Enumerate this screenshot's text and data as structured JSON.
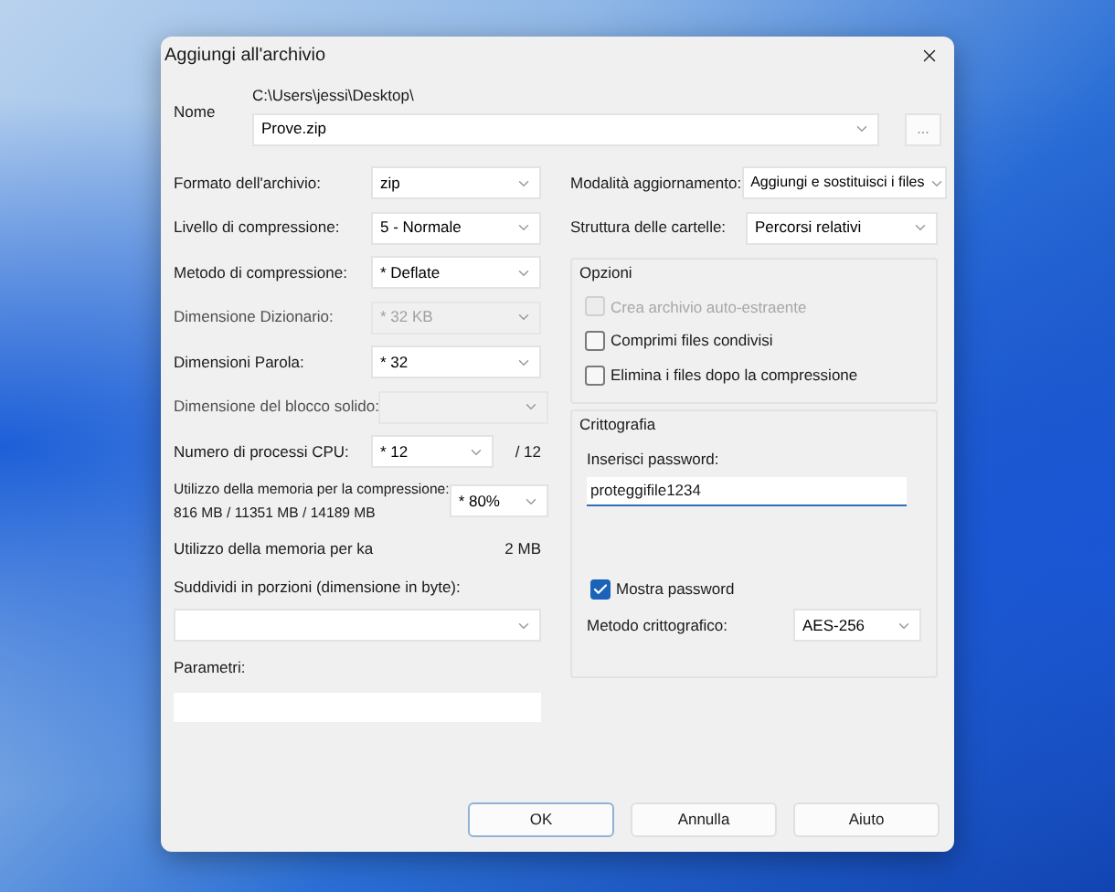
{
  "window": {
    "title": "Aggiungi all'archivio"
  },
  "name": {
    "label": "Nome",
    "path": "C:\\Users\\jessi\\Desktop\\",
    "value": "Prove.zip",
    "browse": "..."
  },
  "left_rows": [
    {
      "kind": "select",
      "label": "Formato dell'archivio:",
      "value": "zip",
      "disabled": false
    },
    {
      "kind": "select",
      "label": "Livello di compressione:",
      "value": "5 - Normale",
      "disabled": false
    },
    {
      "kind": "select",
      "label": "Metodo di compressione:",
      "value": "* Deflate",
      "disabled": false
    },
    {
      "kind": "select",
      "label": "Dimensione Dizionario:",
      "value": "* 32 KB",
      "disabled": true
    },
    {
      "kind": "select",
      "label": "Dimensioni Parola:",
      "value": "* 32",
      "disabled": false
    },
    {
      "kind": "select",
      "label": "Dimensione del blocco solido:",
      "disabled": true
    },
    {
      "kind": "select_suffix",
      "label": "Numero di processi CPU:",
      "value": "* 12",
      "suffix": "/ 12",
      "disabled": false
    },
    {
      "kind": "memory",
      "label": "Utilizzo della memoria per la compressione:",
      "sublabel": "816 MB / 11351 MB / 14189 MB",
      "value": "* 80%",
      "disabled": false
    },
    {
      "kind": "info",
      "label": "Utilizzo della memoria per ka",
      "reading": "2 MB"
    }
  ],
  "split": {
    "label": "Suddividi in porzioni (dimensione in byte):"
  },
  "parameters": {
    "label": "Parametri:"
  },
  "update_mode": {
    "label": "Modalità aggiornamento:",
    "value": "Aggiungi e sostituisci i files"
  },
  "folder_structure": {
    "label": "Struttura delle cartelle:",
    "value": "Percorsi relativi"
  },
  "options": {
    "title": "Opzioni",
    "items": [
      {
        "label": "Crea archivio auto-estraente",
        "checked": false,
        "disabled": true
      },
      {
        "label": "Comprimi files condivisi",
        "checked": false,
        "disabled": false
      },
      {
        "label": "Elimina i files dopo la compressione",
        "checked": false,
        "disabled": false
      }
    ]
  },
  "encryption": {
    "title": "Crittografia",
    "password_label": "Inserisci password:",
    "password": "proteggifile1234",
    "show_password": {
      "label": "Mostra password",
      "checked": true
    },
    "method_label": "Metodo crittografico:",
    "method": "AES-256"
  },
  "buttons": [
    {
      "label": "OK",
      "focused": true
    },
    {
      "label": "Annulla",
      "focused": false
    },
    {
      "label": "Aiuto",
      "focused": false
    }
  ]
}
